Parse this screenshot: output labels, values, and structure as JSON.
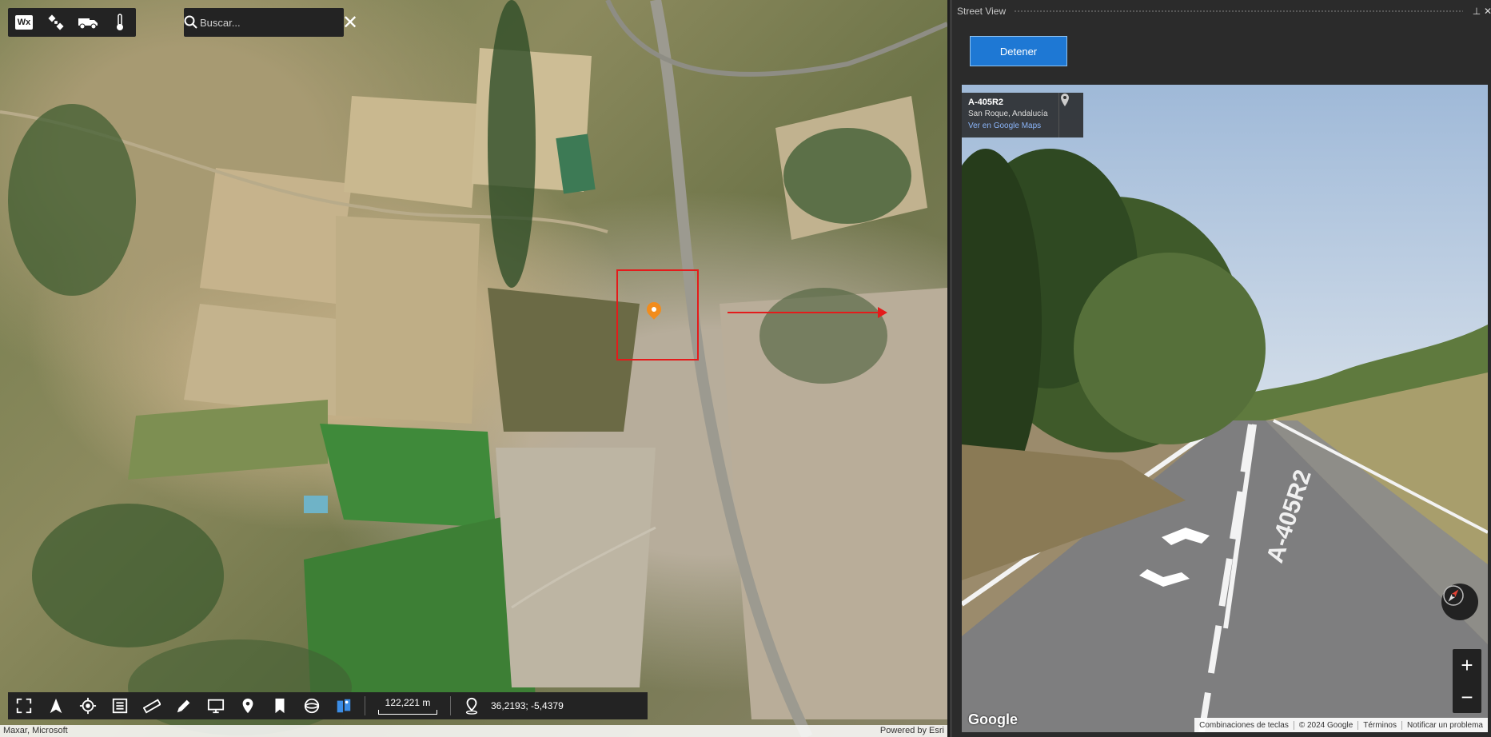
{
  "map": {
    "toolbar_icons": [
      "wx-weather-icon",
      "satellite-icon",
      "truck-icon",
      "thermometer-icon"
    ],
    "wx_label": "Wx",
    "search": {
      "placeholder": "Buscar...",
      "clear_icon": "close-icon"
    },
    "bottom_tools": [
      "fullscreen-icon",
      "north-arrow-icon",
      "locate-icon",
      "list-icon",
      "ruler-icon",
      "pencil-icon",
      "screen-icon",
      "place-pin-icon",
      "bookmark-icon",
      "globe-icon",
      "street-view-icon"
    ],
    "scale_label": "122,221 m",
    "coordinates": "36,2193; -5,4379",
    "attribution_left": "Maxar, Microsoft",
    "attribution_right": "Powered by Esri",
    "marker_color": "#f28c1c",
    "highlight_color": "#e41b1b"
  },
  "panel": {
    "title": "Street View",
    "stop_button": "Detener",
    "streetview": {
      "road_name": "A-405R2",
      "location": "San Roque, Andalucía",
      "maps_link": "Ver en Google Maps",
      "road_marking": "A-405R2",
      "google_logo": "Google",
      "footer": [
        "Combinaciones de teclas",
        "© 2024 Google",
        "Términos",
        "Notificar un problema"
      ]
    }
  }
}
